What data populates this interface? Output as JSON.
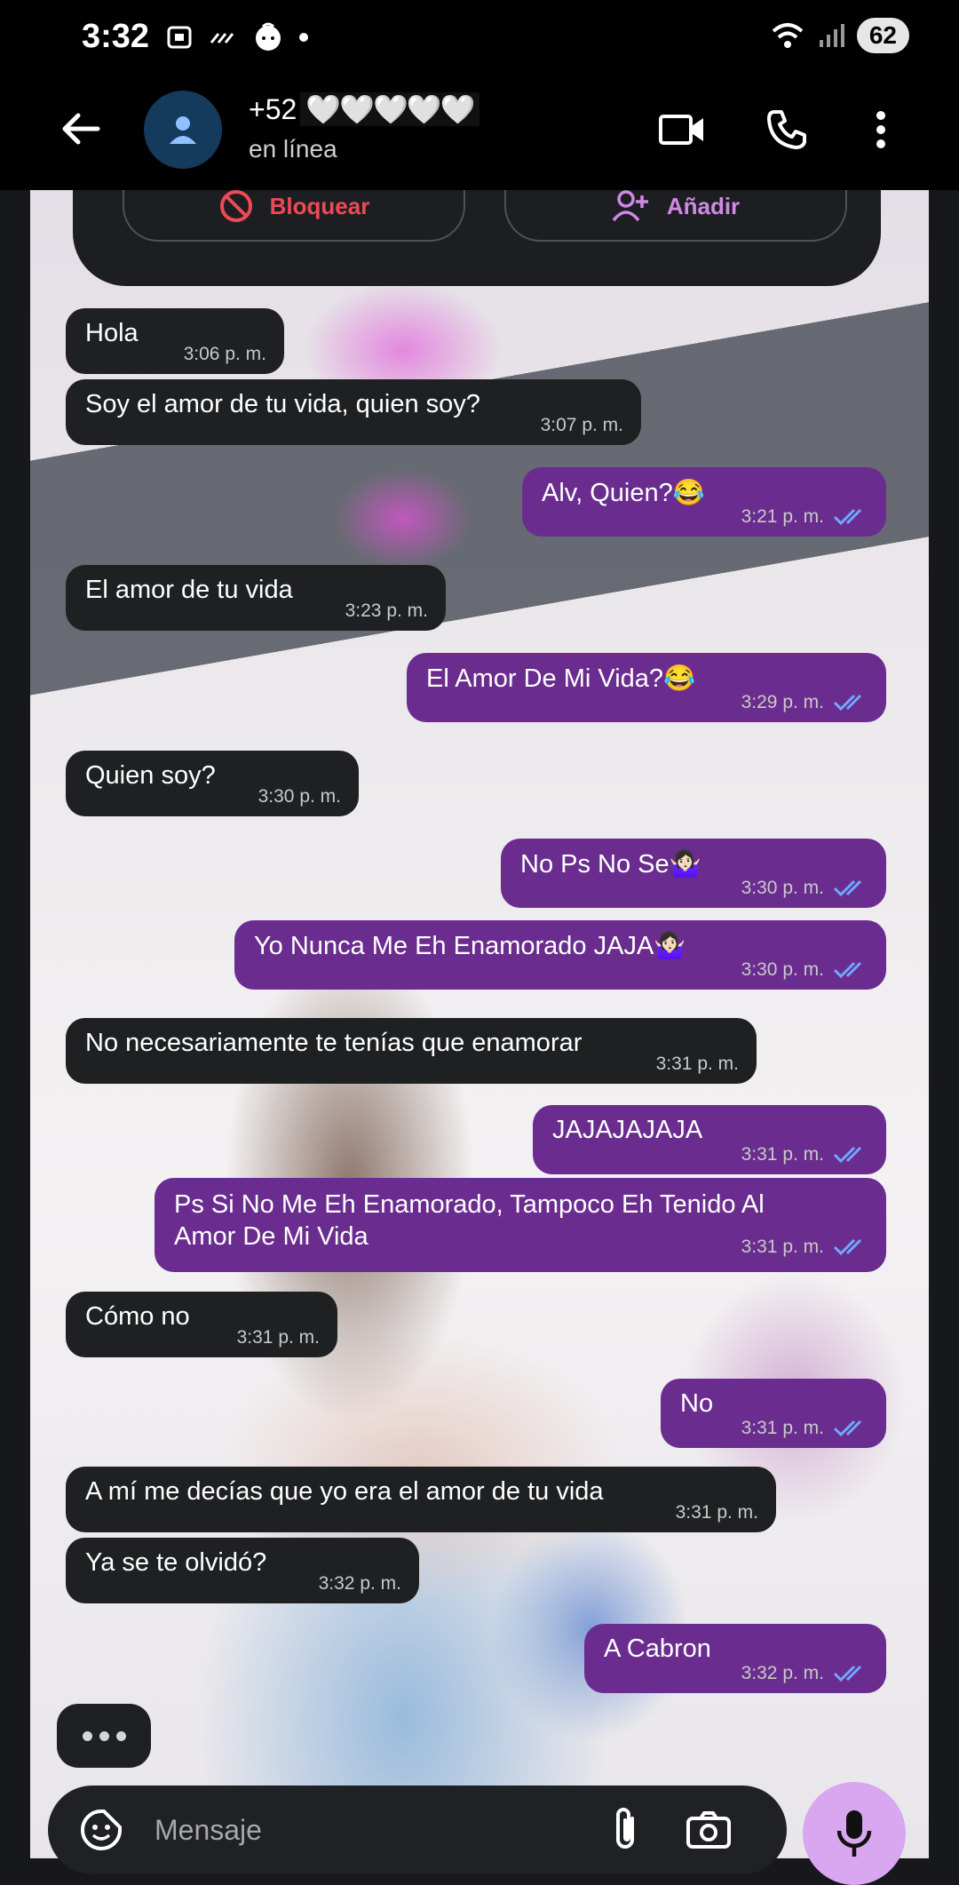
{
  "status_bar": {
    "time": "3:32",
    "battery": "62"
  },
  "header": {
    "contact_prefix": "+52",
    "contact_masked": "🤍🤍🤍🤍🤍",
    "status": "en línea"
  },
  "contact_card": {
    "block_label": "Bloquear",
    "add_label": "Añadir"
  },
  "messages": [
    {
      "dir": "in",
      "text": "Hola",
      "time": "3:06 p. m."
    },
    {
      "dir": "in",
      "text": "Soy el amor de tu vida, quien soy?",
      "time": "3:07 p. m."
    },
    {
      "dir": "out",
      "text": "Alv, Quien?😂",
      "time": "3:21 p. m."
    },
    {
      "dir": "in",
      "text": "El amor de tu vida",
      "time": "3:23 p. m."
    },
    {
      "dir": "out",
      "text": "El Amor De Mi Vida?😂",
      "time": "3:29 p. m."
    },
    {
      "dir": "in",
      "text": "Quien soy?",
      "time": "3:30 p. m."
    },
    {
      "dir": "out",
      "text": "No Ps No Se🤷🏻‍♀️",
      "time": "3:30 p. m."
    },
    {
      "dir": "out",
      "text": "Yo Nunca Me Eh Enamorado JAJA🤷🏻‍♀️",
      "time": "3:30 p. m."
    },
    {
      "dir": "in",
      "text": "No necesariamente te tenías que enamorar",
      "time": "3:31 p. m."
    },
    {
      "dir": "out",
      "text": "JAJAJAJAJA",
      "time": "3:31 p. m."
    },
    {
      "dir": "out",
      "text": "Ps Si No Me Eh Enamorado, Tampoco Eh Tenido Al Amor De Mi Vida",
      "time": "3:31 p. m."
    },
    {
      "dir": "in",
      "text": "Cómo no",
      "time": "3:31 p. m."
    },
    {
      "dir": "out",
      "text": "No",
      "time": "3:31 p. m."
    },
    {
      "dir": "in",
      "text": "A mí me decías que yo era el amor de tu vida",
      "time": "3:31 p. m."
    },
    {
      "dir": "in",
      "text": "Ya se te olvidó?",
      "time": "3:32 p. m."
    },
    {
      "dir": "out",
      "text": "A Cabron",
      "time": "3:32 p. m."
    }
  ],
  "composer": {
    "placeholder": "Mensaje"
  },
  "colors": {
    "incoming": "#1f2022",
    "outgoing": "#6a2d8f",
    "read_ticks": "#6fa8ff",
    "mic": "#d9a6f0",
    "block": "#ee4a55",
    "add": "#d089e6"
  },
  "icons": [
    "back-arrow-icon",
    "avatar-person-icon",
    "video-call-icon",
    "phone-icon",
    "more-vert-icon",
    "block-icon",
    "add-person-icon",
    "sticker-icon",
    "attach-icon",
    "camera-icon",
    "mic-icon"
  ]
}
